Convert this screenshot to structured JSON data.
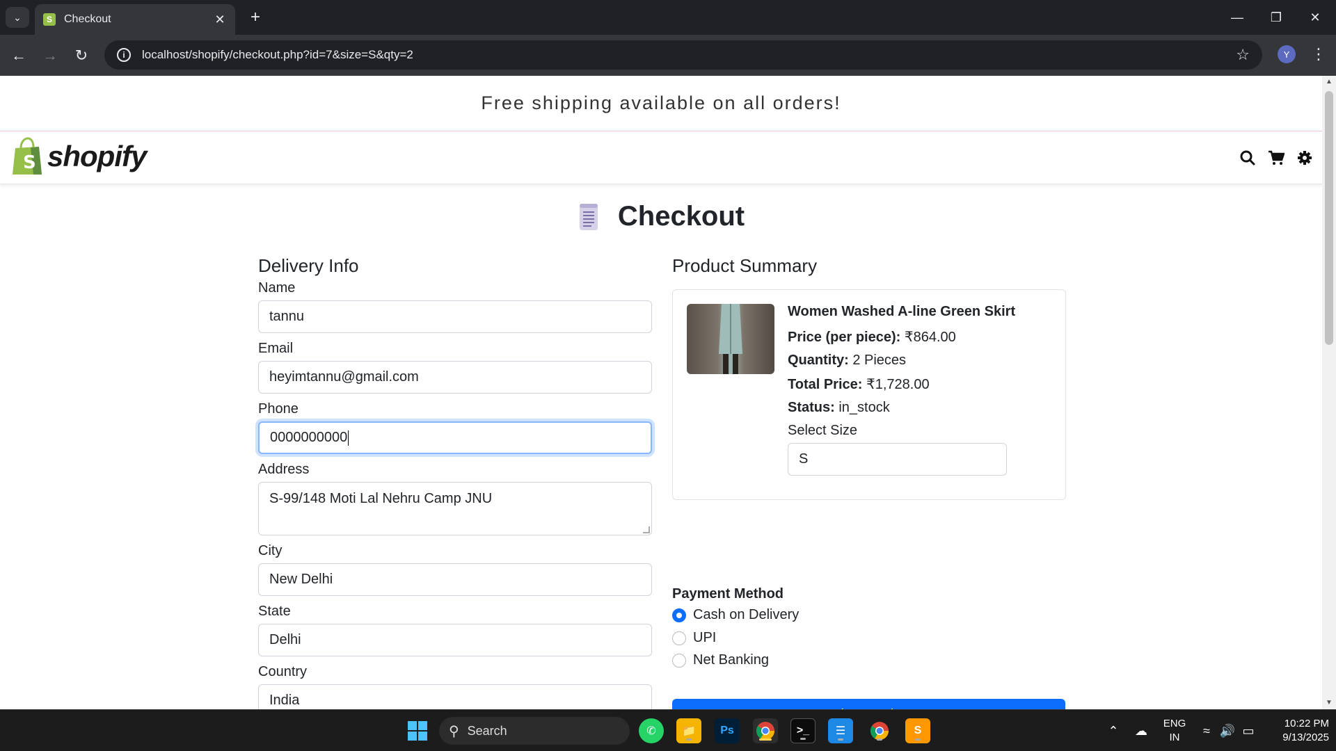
{
  "browser": {
    "tab_title": "Checkout",
    "url": "localhost/shopify/checkout.php?id=7&size=S&qty=2",
    "profile_initial": "Y"
  },
  "announcement": "Free shipping available on all orders!",
  "header": {
    "logo_text": "shopify",
    "icons": [
      "search-icon",
      "cart-icon",
      "gear-icon"
    ]
  },
  "page_title": "Checkout",
  "delivery": {
    "heading": "Delivery Info",
    "fields": [
      {
        "label": "Name",
        "value": "tannu"
      },
      {
        "label": "Email",
        "value": "heyimtannu@gmail.com"
      },
      {
        "label": "Phone",
        "value": "0000000000"
      },
      {
        "label": "Address",
        "value": "S-99/148 Moti Lal Nehru Camp JNU"
      },
      {
        "label": "City",
        "value": "New Delhi"
      },
      {
        "label": "State",
        "value": "Delhi"
      },
      {
        "label": "Country",
        "value": "India"
      }
    ]
  },
  "summary": {
    "heading": "Product Summary",
    "product_name": "Women Washed A-line Green Skirt",
    "price_label": "Price (per piece):",
    "price_value": "₹864.00",
    "qty_label": "Quantity:",
    "qty_value": "2 Pieces",
    "total_label": "Total Price:",
    "total_value": "₹1,728.00",
    "status_label": "Status:",
    "status_value": "in_stock",
    "size_label": "Select Size",
    "size_value": "S"
  },
  "payment": {
    "heading": "Payment Method",
    "options": [
      "Cash on Delivery",
      "UPI",
      "Net Banking"
    ],
    "selected": "Cash on Delivery"
  },
  "place_order_label": "Place Order",
  "taskbar": {
    "search_label": "Search",
    "lang_top": "ENG",
    "lang_bottom": "IN",
    "time": "10:22 PM",
    "date": "9/13/2025"
  },
  "colors": {
    "primary": "#0d6efd",
    "shopify_green": "#95bf47",
    "chrome_dark": "#202124"
  }
}
